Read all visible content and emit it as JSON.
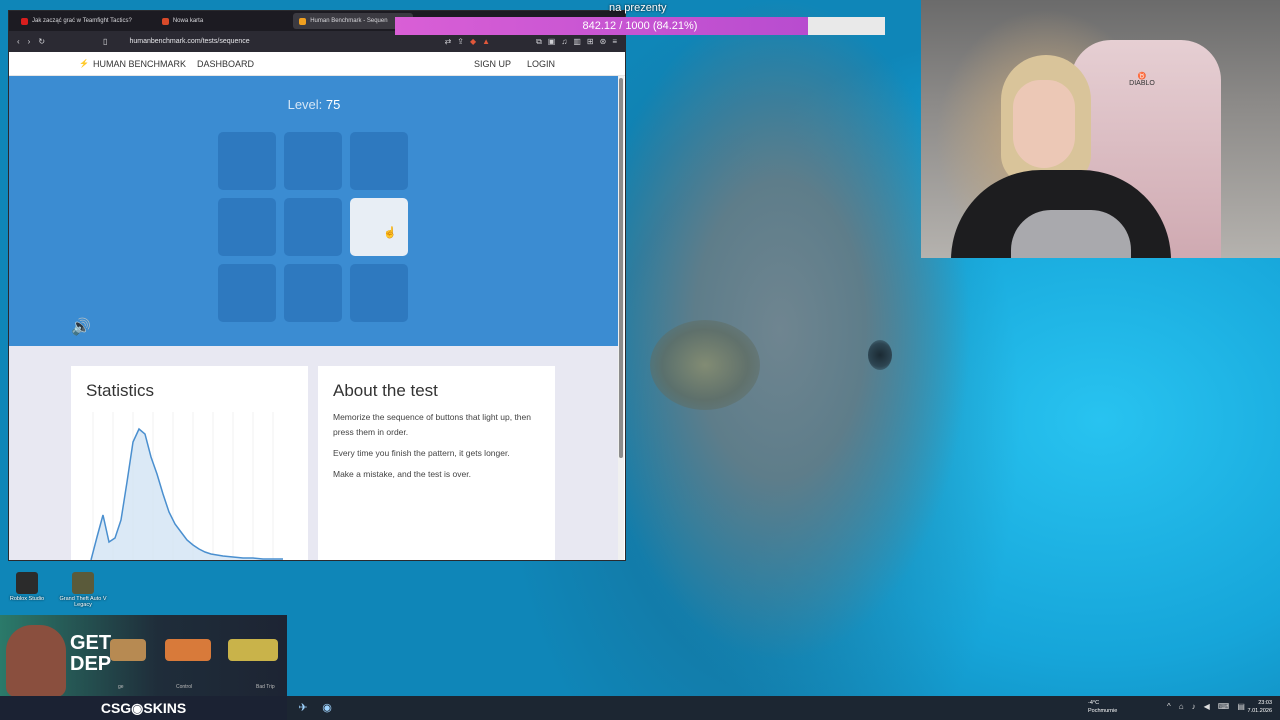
{
  "stream": {
    "goal_label": "na prezenty",
    "goal_text": "842.12 / 1000 (84.21%)",
    "goal_fraction": 0.8421
  },
  "browser": {
    "tabs": [
      {
        "title": "Jak zacząć grać w Teamfight Tactics?",
        "fav_color": "#d81e1e"
      },
      {
        "title": "Nowa karta",
        "fav_color": "#d84a2a"
      },
      {
        "title": "Human Benchmark - Sequen",
        "fav_color": "#f0a020",
        "active": true
      }
    ],
    "url": "humanbenchmark.com/tests/sequence"
  },
  "site": {
    "brand": "HUMAN BENCHMARK",
    "dashboard": "DASHBOARD",
    "sign_up": "SIGN UP",
    "login": "LOGIN"
  },
  "game": {
    "level_label": "Level:",
    "level_value": "75",
    "lit_cell": 5
  },
  "statistics": {
    "title": "Statistics"
  },
  "about": {
    "title": "About the test",
    "p1": "Memorize the sequence of buttons that light up, then press them in order.",
    "p2": "Every time you finish the pattern, it gets longer.",
    "p3": "Make a mistake, and the test is over."
  },
  "desktop": {
    "icons": [
      {
        "label": "Roblox Studio"
      },
      {
        "label": "Grand Theft Auto V Legacy"
      }
    ]
  },
  "promo": {
    "headline": "GET DEP",
    "labels": [
      "ge",
      "Control",
      "Bad Trip"
    ],
    "brand": "CSG◉SKINS"
  },
  "taskbar": {
    "weather_temp": "-4°C",
    "weather_desc": "Pochmurnie",
    "time": "23:03",
    "date": "7.01.2026"
  },
  "colors": {
    "game_bg": "#3b8cd2",
    "cell": "#2e79bf",
    "lit_cell": "#e8eef5",
    "goal_fill": "#c957d3"
  }
}
